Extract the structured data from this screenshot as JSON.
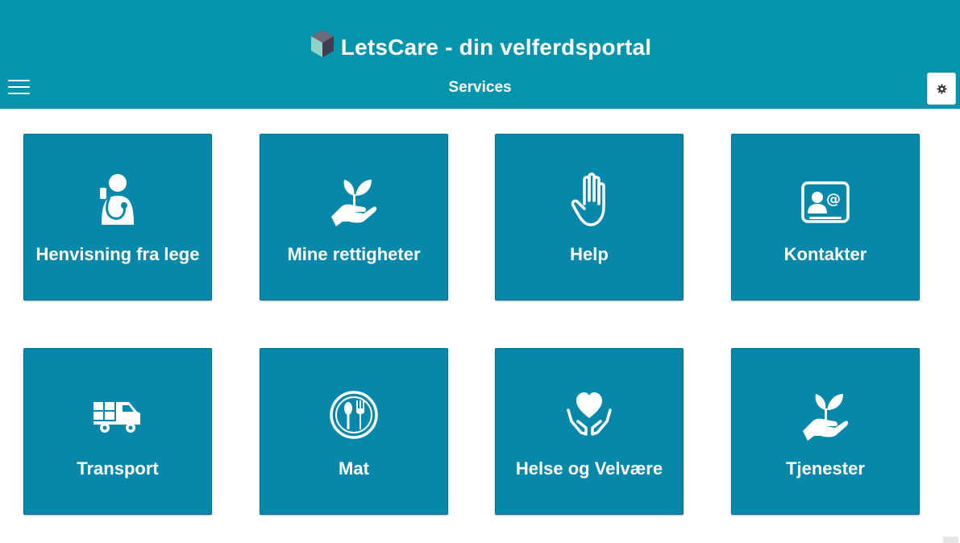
{
  "header": {
    "app_title": "LetsCare - din velferdsportal",
    "page_title": "Services",
    "logo": "hexagon-logo",
    "menu_icon": "hamburger-menu-icon",
    "settings_icon": "gear-icon"
  },
  "tiles": [
    {
      "label": "Henvisning fra lege",
      "icon": "doctor-icon"
    },
    {
      "label": "Mine rettigheter",
      "icon": "hand-plant-icon"
    },
    {
      "label": "Help",
      "icon": "raised-hand-icon"
    },
    {
      "label": "Kontakter",
      "icon": "contact-card-icon"
    },
    {
      "label": "Transport",
      "icon": "delivery-truck-icon"
    },
    {
      "label": "Mat",
      "icon": "plate-cutlery-icon"
    },
    {
      "label": "Helse og Velvære",
      "icon": "hands-heart-icon"
    },
    {
      "label": "Tjenester",
      "icon": "hand-plant-icon"
    }
  ],
  "colors": {
    "header_bg": "#0494ac",
    "tile_bg": "#0788ab",
    "text": "#ffffff"
  }
}
